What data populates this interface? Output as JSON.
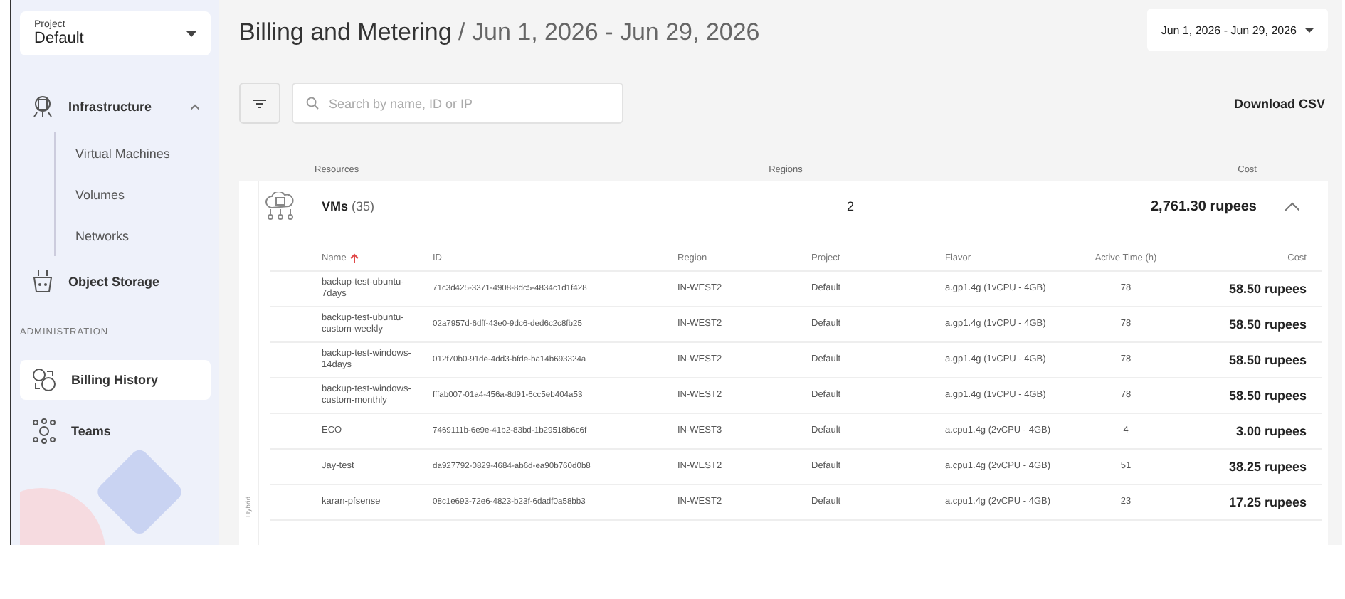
{
  "sidebar": {
    "project_select": {
      "label": "Project",
      "value": "Default"
    },
    "items": [
      {
        "kind": "group",
        "label": "Infrastructure",
        "expanded": true,
        "selected": false,
        "children": [
          {
            "label": "Virtual Machines"
          },
          {
            "label": "Volumes"
          },
          {
            "label": "Networks"
          }
        ]
      },
      {
        "kind": "item",
        "label": "Object Storage",
        "selected": false
      },
      {
        "kind": "section",
        "label": "ADMINISTRATION"
      },
      {
        "kind": "item",
        "label": "Billing History",
        "selected": true
      },
      {
        "kind": "item",
        "label": "Teams",
        "selected": false
      }
    ]
  },
  "header": {
    "title": "Billing and Metering",
    "subtitle": "/ Jun 1, 2026 - Jun 29, 2026",
    "date_range": "Jun 1, 2026 - Jun 29, 2026"
  },
  "toolbar": {
    "search": {
      "placeholder": "Search by name, ID or IP"
    },
    "download": "Download CSV"
  },
  "summary_columns": [
    "Resources",
    "Regions",
    "Cost"
  ],
  "side_label": "Hybrid",
  "groups": [
    {
      "name": "VMs",
      "count": "(35)",
      "regions": "2",
      "cost": "2,761.30 rupees",
      "expanded": true,
      "columns": [
        {
          "label": "Name",
          "sorted": true
        },
        {
          "label": "ID",
          "sorted": false
        },
        {
          "label": "Region",
          "sorted": false
        },
        {
          "label": "Project",
          "sorted": false
        },
        {
          "label": "Flavor",
          "sorted": false
        },
        {
          "label": "Active Time (h)",
          "sorted": false
        },
        {
          "label": "Cost",
          "sorted": false
        }
      ],
      "rows": [
        [
          "backup-test-ubuntu-7days",
          "71c3d425-3371-4908-8dc5-4834c1d1f428",
          "IN-WEST2",
          "Default",
          "a.gp1.4g (1vCPU - 4GB)",
          "78",
          "58.50 rupees"
        ],
        [
          "backup-test-ubuntu-custom-weekly",
          "02a7957d-6dff-43e0-9dc6-ded6c2c8fb25",
          "IN-WEST2",
          "Default",
          "a.gp1.4g (1vCPU - 4GB)",
          "78",
          "58.50 rupees"
        ],
        [
          "backup-test-windows-14days",
          "012f70b0-91de-4dd3-bfde-ba14b693324a",
          "IN-WEST2",
          "Default",
          "a.gp1.4g (1vCPU - 4GB)",
          "78",
          "58.50 rupees"
        ],
        [
          "backup-test-windows-custom-monthly",
          "fffab007-01a4-456a-8d91-6cc5eb404a53",
          "IN-WEST2",
          "Default",
          "a.gp1.4g (1vCPU - 4GB)",
          "78",
          "58.50 rupees"
        ],
        [
          "ECO",
          "7469111b-6e9e-41b2-83bd-1b29518b6c6f",
          "IN-WEST3",
          "Default",
          "a.cpu1.4g (2vCPU - 4GB)",
          "4",
          "3.00 rupees"
        ],
        [
          "Jay-test",
          "da927792-0829-4684-ab6d-ea90b760d0b8",
          "IN-WEST2",
          "Default",
          "a.cpu1.4g (2vCPU - 4GB)",
          "51",
          "38.25 rupees"
        ],
        [
          "karan-pfsense",
          "08c1e693-72e6-4823-b23f-6dadf0a58bb3",
          "IN-WEST2",
          "Default",
          "a.cpu1.4g (2vCPU - 4GB)",
          "23",
          "17.25 rupees"
        ]
      ]
    }
  ]
}
